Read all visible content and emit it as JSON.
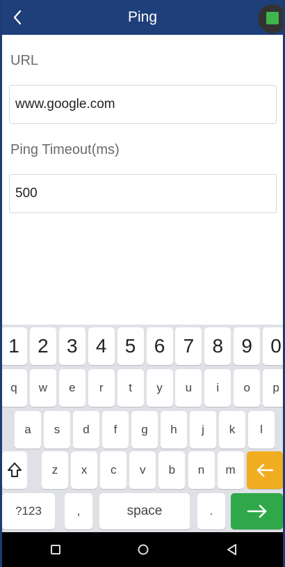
{
  "header": {
    "title": "Ping"
  },
  "form": {
    "url_label": "URL",
    "url_value": "www.google.com",
    "timeout_label": "Ping Timeout(ms)",
    "timeout_value": "500"
  },
  "keyboard": {
    "row_numbers": [
      "1",
      "2",
      "3",
      "4",
      "5",
      "6",
      "7",
      "8",
      "9",
      "0"
    ],
    "row_top": [
      "q",
      "w",
      "e",
      "r",
      "t",
      "y",
      "u",
      "i",
      "o",
      "p"
    ],
    "row_mid": [
      "a",
      "s",
      "d",
      "f",
      "g",
      "h",
      "j",
      "k",
      "l"
    ],
    "row_bottom": [
      "z",
      "x",
      "c",
      "v",
      "b",
      "n",
      "m"
    ],
    "symbols_key": "?123",
    "comma_key": ",",
    "space_key": "space",
    "period_key": ".",
    "colors": {
      "backspace": "#f0ad1f",
      "enter": "#2fa84a",
      "background": "#dfe1e6"
    }
  },
  "icons": {
    "back": "chevron-left-icon",
    "shift": "shift-arrow-icon",
    "backspace": "arrow-left-icon",
    "enter": "arrow-right-icon",
    "nav_recent": "square-icon",
    "nav_home": "circle-icon",
    "nav_back": "triangle-icon"
  }
}
